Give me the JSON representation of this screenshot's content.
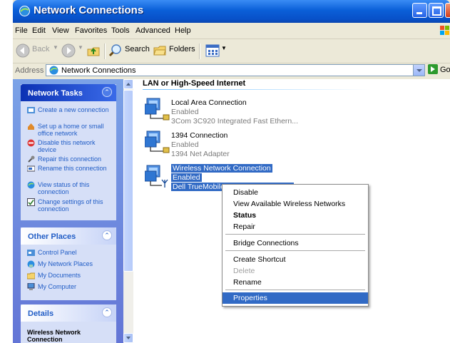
{
  "window": {
    "title": "Network Connections"
  },
  "menubar": {
    "items": [
      "File",
      "Edit",
      "View",
      "Favorites",
      "Tools",
      "Advanced",
      "Help"
    ]
  },
  "toolbar": {
    "back": "Back",
    "search": "Search",
    "folders": "Folders"
  },
  "address": {
    "label": "Address",
    "value": "Network Connections",
    "go": "Go"
  },
  "left_panels": {
    "network_tasks": {
      "title": "Network Tasks",
      "items": [
        "Create a new connection",
        "Set up a home or small office network",
        "Disable this network device",
        "Repair this connection",
        "Rename this connection",
        "View status of this connection",
        "Change settings of this connection"
      ]
    },
    "other_places": {
      "title": "Other Places",
      "items": [
        "Control Panel",
        "My Network Places",
        "My Documents",
        "My Computer"
      ]
    },
    "details": {
      "title": "Details",
      "selection": "Wireless Network Connection"
    }
  },
  "group": {
    "title": "LAN or High-Speed Internet"
  },
  "connections": [
    {
      "name": "Local Area Connection",
      "status": "Enabled",
      "device": "3Com 3C920 Integrated Fast Ethern..."
    },
    {
      "name": "1394 Connection",
      "status": "Enabled",
      "device": "1394 Net Adapter"
    },
    {
      "name": "Wireless Network Connection",
      "status": "Enabled",
      "device": "Dell TrueMobile"
    }
  ],
  "context_menu": {
    "items": {
      "disable": "Disable",
      "view_wireless": "View Available Wireless Networks",
      "status": "Status",
      "repair": "Repair",
      "bridge": "Bridge Connections",
      "shortcut": "Create Shortcut",
      "delete": "Delete",
      "rename": "Rename",
      "properties": "Properties"
    }
  },
  "colors": {
    "title_bar": "#0a5fd8",
    "selection": "#316ac5",
    "task_pane": "#6375d6"
  }
}
